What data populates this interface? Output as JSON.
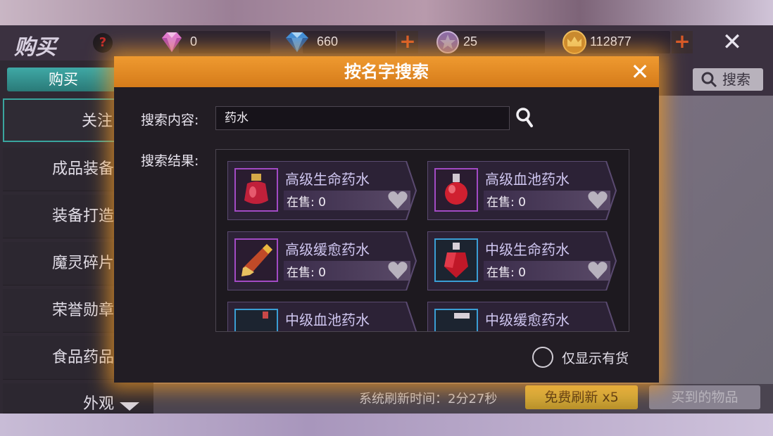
{
  "header": {
    "title": "购买",
    "help_icon": "?",
    "currencies": [
      {
        "icon": "pink-diamond-icon",
        "value": "0"
      },
      {
        "icon": "blue-diamond-icon",
        "value": "660"
      },
      {
        "icon": "star-coin-icon",
        "value": "25"
      },
      {
        "icon": "crown-coin-icon",
        "value": "112877"
      }
    ],
    "plus": "+",
    "close": "✕"
  },
  "sidebar": {
    "tab_label": "购买",
    "items": [
      {
        "label": "关注"
      },
      {
        "label": "成品装备"
      },
      {
        "label": "装备打造"
      },
      {
        "label": "魔灵碎片"
      },
      {
        "label": "荣誉勋章"
      },
      {
        "label": "食品药品"
      },
      {
        "label": "外观"
      }
    ]
  },
  "toolbar": {
    "search_label": "搜索"
  },
  "footer": {
    "refresh_time": "系统刷新时间：2分27秒",
    "free_refresh": "免费刷新 x5",
    "bought_items": "买到的物品"
  },
  "dialog": {
    "title": "按名字搜索",
    "close": "✕",
    "search_label": "搜索内容:",
    "search_value": "药水",
    "results_label": "搜索结果:",
    "in_stock_only": "仅显示有货",
    "results": [
      {
        "name": "高级生命药水",
        "stock": "在售: 0"
      },
      {
        "name": "高级血池药水",
        "stock": "在售: 0"
      },
      {
        "name": "高级缓愈药水",
        "stock": "在售: 0"
      },
      {
        "name": "中级生命药水",
        "stock": "在售: 0"
      },
      {
        "name": "中级血池药水",
        "stock": ""
      },
      {
        "name": "中级缓愈药水",
        "stock": ""
      }
    ]
  },
  "colors": {
    "accent_orange": "#e88a24",
    "teal_tab": "#3aa59e",
    "purple_rarity": "#a24ac4",
    "blue_rarity": "#3a9ed4",
    "gold_button": "#d8ac3a"
  }
}
